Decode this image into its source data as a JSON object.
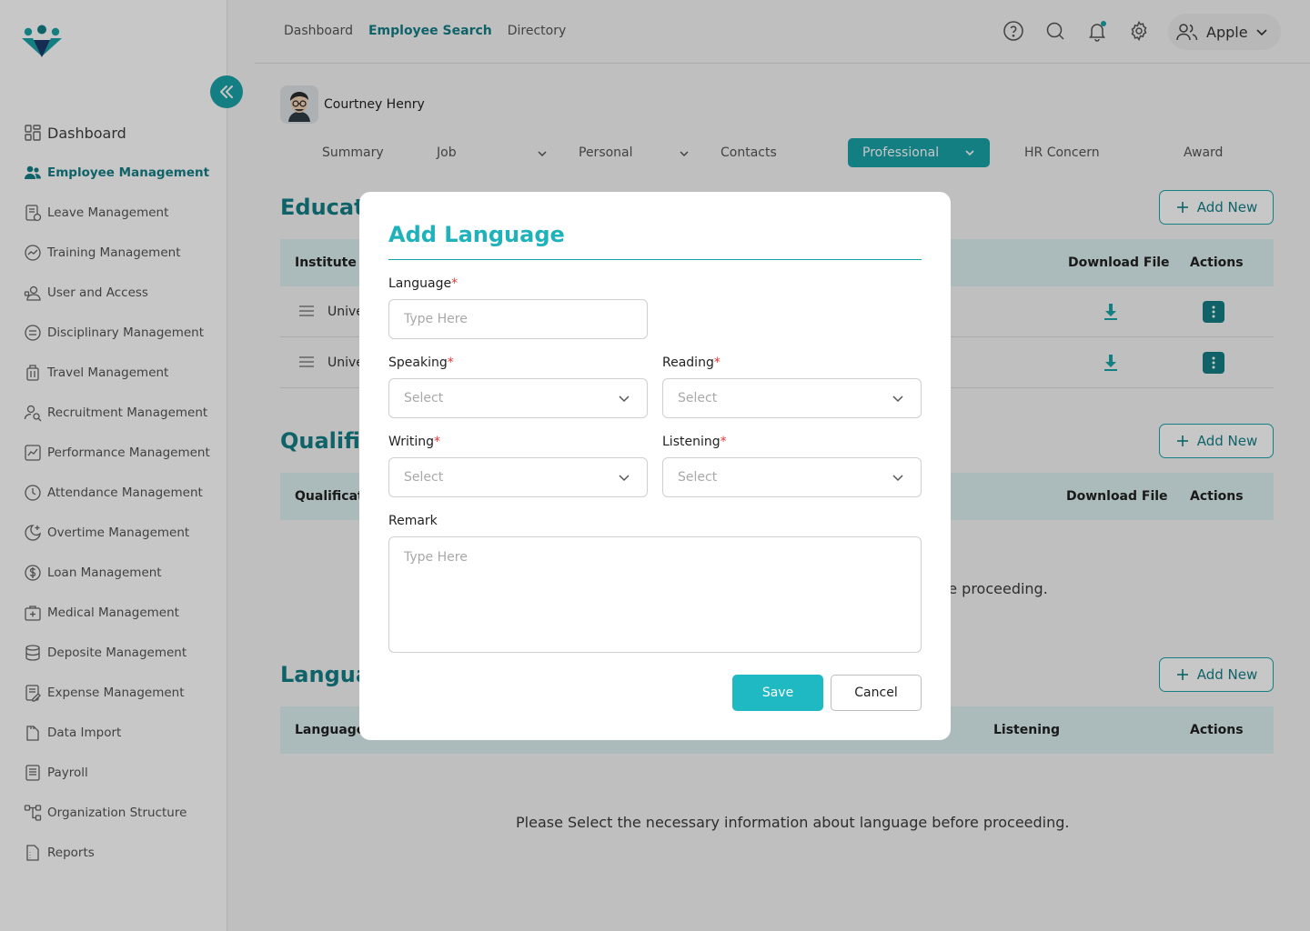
{
  "topnav": {
    "dashboard": "Dashboard",
    "employee_search": "Employee Search",
    "directory": "Directory"
  },
  "user": {
    "name": "Apple"
  },
  "sidebar": {
    "items": [
      {
        "label": "Dashboard"
      },
      {
        "label": "Employee Management"
      },
      {
        "label": "Leave Management"
      },
      {
        "label": "Training Management"
      },
      {
        "label": "User and Access"
      },
      {
        "label": "Disciplinary Management"
      },
      {
        "label": "Travel Management"
      },
      {
        "label": "Recruitment Management"
      },
      {
        "label": "Performance Management"
      },
      {
        "label": "Attendance Management"
      },
      {
        "label": "Overtime Management"
      },
      {
        "label": "Loan Management"
      },
      {
        "label": "Medical Management"
      },
      {
        "label": "Deposite Management"
      },
      {
        "label": "Expense Management"
      },
      {
        "label": "Data Import"
      },
      {
        "label": "Payroll"
      },
      {
        "label": "Organization Structure"
      },
      {
        "label": "Reports"
      }
    ]
  },
  "employee": {
    "name": "Courtney Henry"
  },
  "tabs": {
    "summary": "Summary",
    "job": "Job",
    "personal": "Personal",
    "contacts": "Contacts",
    "professional": "Professional",
    "hr_concern": "HR Concern",
    "award": "Award"
  },
  "education": {
    "title": "Educati",
    "add_label": "Add New",
    "col_institute": "Institute N",
    "col_download": "Download File",
    "col_actions": "Actions",
    "rows": [
      {
        "text": "Unive"
      },
      {
        "text": "Unive"
      }
    ]
  },
  "qualification": {
    "title": "Qualific",
    "add_label": "Add New",
    "col_qualification": "Qualificati",
    "col_download": "Download File",
    "col_actions": "Actions",
    "empty_message": "re proceeding."
  },
  "language": {
    "title": "Langua",
    "add_label": "Add New",
    "col_language": "Language",
    "col_listening": "Listening",
    "col_actions": "Actions",
    "empty_message": "Please Select the necessary information about language before proceeding."
  },
  "modal": {
    "title": "Add Language",
    "language_label": "Language",
    "language_placeholder": "Type Here",
    "speaking_label": "Speaking",
    "reading_label": "Reading",
    "writing_label": "Writing",
    "listening_label": "Listening",
    "select_placeholder": "Select",
    "remark_label": "Remark",
    "remark_placeholder": "Type Here",
    "required_mark": "*",
    "save_label": "Save",
    "cancel_label": "Cancel"
  },
  "colors": {
    "primary": "#1aa3a8",
    "primary_dark": "#147f86",
    "accent": "#1fb9c4",
    "required": "#e53935"
  }
}
